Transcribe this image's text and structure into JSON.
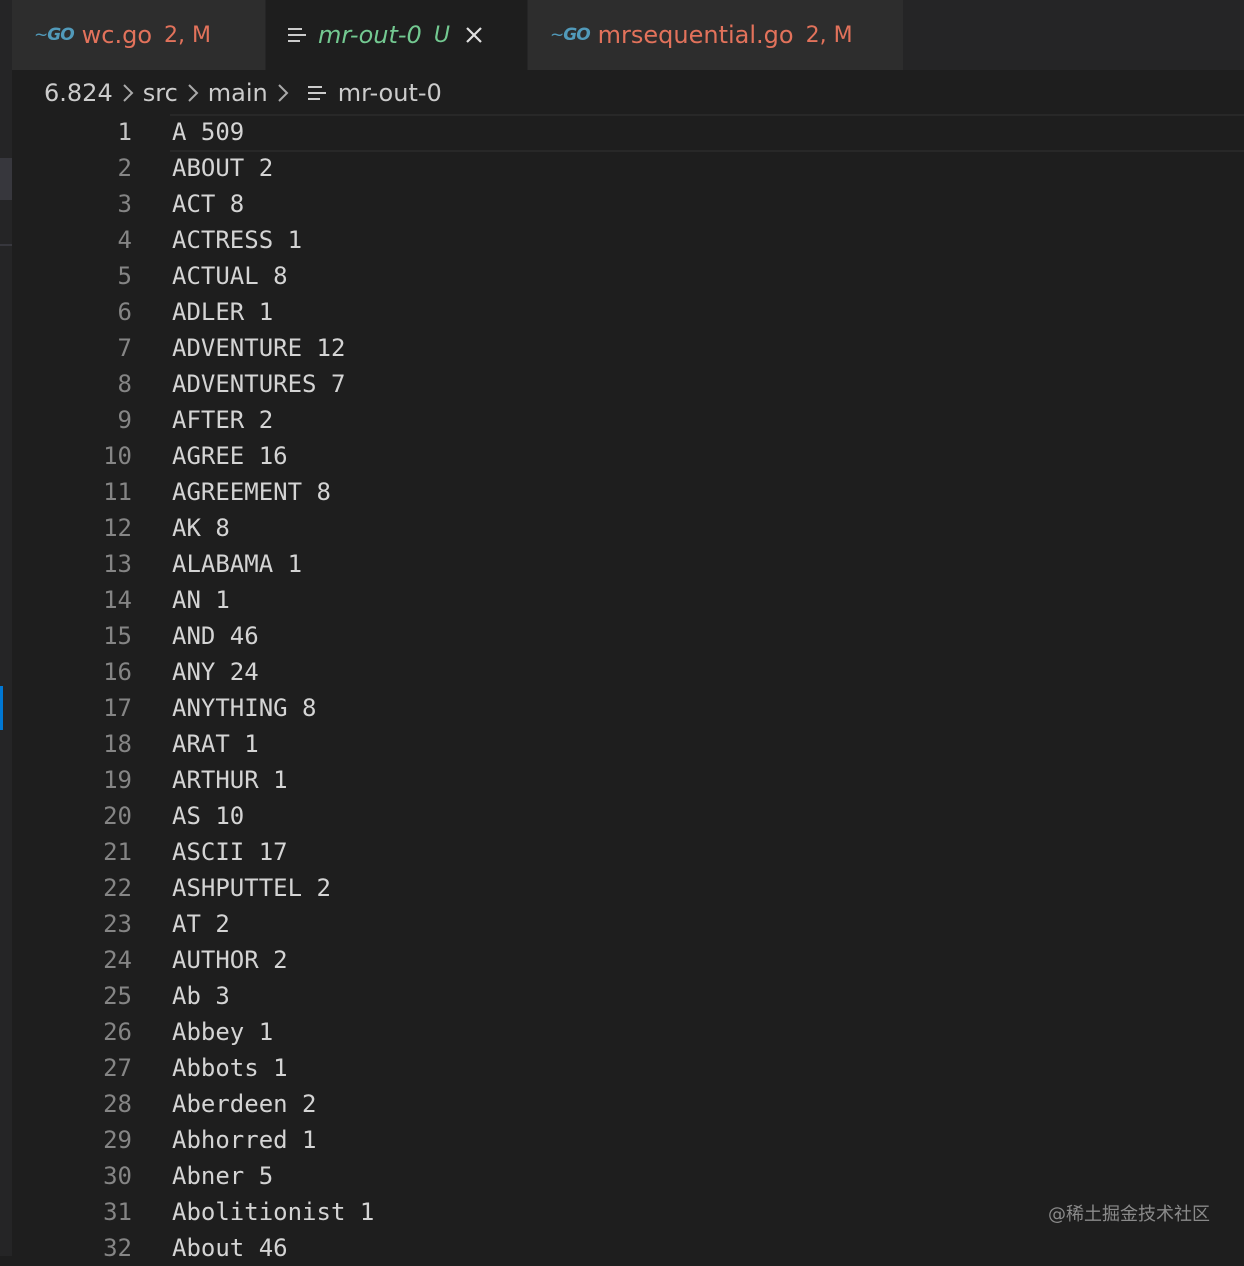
{
  "tabs": [
    {
      "name": "wc.go",
      "badge": "2, M",
      "icon": "go-icon",
      "icon_text": "GO"
    },
    {
      "name": "mr-out-0",
      "badge": "U",
      "icon": "lines-icon"
    },
    {
      "name": "mrsequential.go",
      "badge": "2, M",
      "icon": "go-icon",
      "icon_text": "GO"
    }
  ],
  "breadcrumb": [
    "6.824",
    "src",
    "main",
    "mr-out-0"
  ],
  "colors": {
    "modified": "#e2725b",
    "untracked": "#73c991",
    "go": "#519aba",
    "accent": "#0078d4"
  },
  "lines": [
    "A 509",
    "ABOUT 2",
    "ACT 8",
    "ACTRESS 1",
    "ACTUAL 8",
    "ADLER 1",
    "ADVENTURE 12",
    "ADVENTURES 7",
    "AFTER 2",
    "AGREE 16",
    "AGREEMENT 8",
    "AK 8",
    "ALABAMA 1",
    "AN 1",
    "AND 46",
    "ANY 24",
    "ANYTHING 8",
    "ARAT 1",
    "ARTHUR 1",
    "AS 10",
    "ASCII 17",
    "ASHPUTTEL 2",
    "AT 2",
    "AUTHOR 2",
    "Ab 3",
    "Abbey 1",
    "Abbots 1",
    "Aberdeen 2",
    "Abhorred 1",
    "Abner 5",
    "Abolitionist 1",
    "About 46"
  ],
  "watermark": "@稀土掘金技术社区"
}
